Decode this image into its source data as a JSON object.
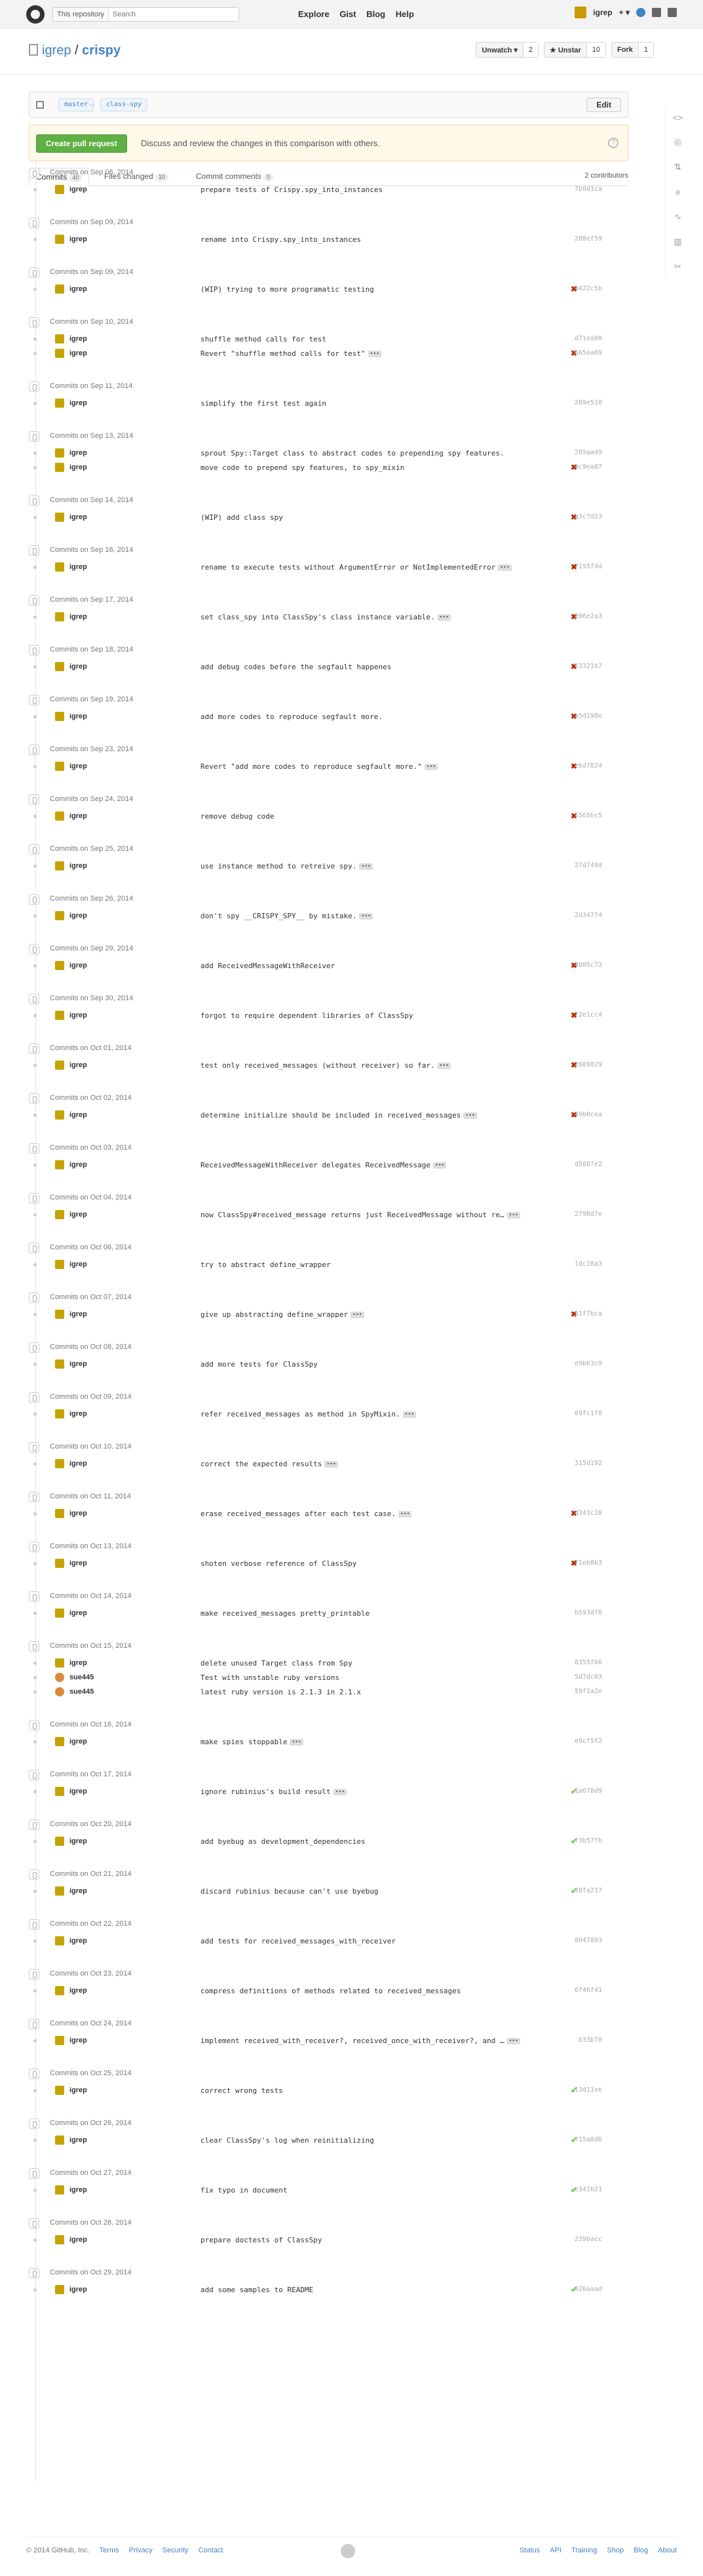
{
  "header": {
    "search_scope": "This repository",
    "search_placeholder": "Search",
    "nav": [
      "Explore",
      "Gist",
      "Blog",
      "Help"
    ],
    "username": "igrep",
    "plus": "+ ▾"
  },
  "repo": {
    "owner": "igrep",
    "separator": "/",
    "name": "crispy",
    "unwatch_label": "Unwatch ▾",
    "unwatch_count": "2",
    "unstar_label": "★ Unstar",
    "unstar_count": "10",
    "fork_label": "Fork",
    "fork_count": "1"
  },
  "compare": {
    "base": "master",
    "dots": "...",
    "head": "class-spy",
    "edit_label": "Edit",
    "pr_button": "Create pull request",
    "pr_text": "Discuss and review the changes in this comparison with others.",
    "help": "?"
  },
  "tabs": [
    {
      "label": "Commits",
      "count": "40"
    },
    {
      "label": "Files changed",
      "count": "10"
    },
    {
      "label": "Commit comments",
      "count": "0"
    }
  ],
  "contributors": "2 contributors",
  "groups": [
    {
      "date": "Commits on Sep 06, 2014",
      "commits": [
        {
          "author": "igrep",
          "message": "prepare tests of Crispy.spy_into_instances",
          "sha": "7b0d1ca",
          "status": ""
        }
      ]
    },
    {
      "date": "Commits on Sep 09, 2014",
      "commits": [
        {
          "author": "igrep",
          "message": "rename into Crispy.spy_into_instances",
          "sha": "288ef59",
          "status": ""
        }
      ]
    },
    {
      "date": "Commits on Sep 09, 2014",
      "commits": [
        {
          "author": "igrep",
          "message": "(WIP) trying to more programatic testing",
          "sha": "4422c5b",
          "status": "fail"
        }
      ]
    },
    {
      "date": "Commits on Sep 10, 2014",
      "commits": [
        {
          "author": "igrep",
          "message": "shuffle method calls for test",
          "sha": "d71ea80",
          "status": ""
        },
        {
          "author": "igrep",
          "message": "Revert \"shuffle method calls for test\"",
          "sha": "665ea69",
          "status": "fail",
          "ell": true
        }
      ]
    },
    {
      "date": "Commits on Sep 11, 2014",
      "commits": [
        {
          "author": "igrep",
          "message": "simplify the first test again",
          "sha": "289e510",
          "status": ""
        }
      ]
    },
    {
      "date": "Commits on Sep 13, 2014",
      "commits": [
        {
          "author": "igrep",
          "message": "sprout Spy::Target class to abstract codes to prepending spy features.",
          "sha": "285aa49",
          "status": ""
        },
        {
          "author": "igrep",
          "message": "move code to prepend spy features, to spy_mixin",
          "sha": "4c9ea07",
          "status": "fail"
        }
      ]
    },
    {
      "date": "Commits on Sep 14, 2014",
      "commits": [
        {
          "author": "igrep",
          "message": "(WIP) add class spy",
          "sha": "a3c7d23",
          "status": "fail"
        }
      ]
    },
    {
      "date": "Commits on Sep 16, 2014",
      "commits": [
        {
          "author": "igrep",
          "message": "rename to execute tests without ArgumentError or NotImplementedError",
          "sha": "7155f4d",
          "status": "fail",
          "ell": true
        }
      ]
    },
    {
      "date": "Commits on Sep 17, 2014",
      "commits": [
        {
          "author": "igrep",
          "message": "set class_spy into ClassSpy's class instance variable.",
          "sha": "896e2a3",
          "status": "fail",
          "ell": true
        }
      ]
    },
    {
      "date": "Commits on Sep 18, 2014",
      "commits": [
        {
          "author": "igrep",
          "message": "add debug codes before the segfault happenes",
          "sha": "63321b7",
          "status": "fail"
        }
      ]
    },
    {
      "date": "Commits on Sep 19, 2014",
      "commits": [
        {
          "author": "igrep",
          "message": "add more codes to reproduce segfault more.",
          "sha": "a5d198e",
          "status": "fail"
        }
      ]
    },
    {
      "date": "Commits on Sep 23, 2014",
      "commits": [
        {
          "author": "igrep",
          "message": "Revert \"add more codes to reproduce segfault more.\"",
          "sha": "e6d7824",
          "status": "fail",
          "ell": true
        }
      ]
    },
    {
      "date": "Commits on Sep 24, 2014",
      "commits": [
        {
          "author": "igrep",
          "message": "remove debug code",
          "sha": "5565bc5",
          "status": "fail"
        }
      ]
    },
    {
      "date": "Commits on Sep 25, 2014",
      "commits": [
        {
          "author": "igrep",
          "message": "use instance method to retreive spy.",
          "sha": "27d749d",
          "status": "",
          "ell": true
        }
      ]
    },
    {
      "date": "Commits on Sep 26, 2014",
      "commits": [
        {
          "author": "igrep",
          "message": "don't spy __CRISPY_SPY__ by mistake.",
          "sha": "2d347f4",
          "status": "",
          "ell": true
        }
      ]
    },
    {
      "date": "Commits on Sep 29, 2014",
      "commits": [
        {
          "author": "igrep",
          "message": "add ReceivedMessageWithReceiver",
          "sha": "4805c73",
          "status": "fail"
        }
      ]
    },
    {
      "date": "Commits on Sep 30, 2014",
      "commits": [
        {
          "author": "igrep",
          "message": "forgot to require dependent libraries of ClassSpy",
          "sha": "72e1cc4",
          "status": "fail"
        }
      ]
    },
    {
      "date": "Commits on Oct 01, 2014",
      "commits": [
        {
          "author": "igrep",
          "message": "test only received_messages (without receiver) so far.",
          "sha": "2889829",
          "status": "fail",
          "ell": true
        }
      ]
    },
    {
      "date": "Commits on Oct 02, 2014",
      "commits": [
        {
          "author": "igrep",
          "message": "determine initialize should be included in received_messages",
          "sha": "49b0cea",
          "status": "fail",
          "ell": true
        }
      ]
    },
    {
      "date": "Commits on Oct 03, 2014",
      "commits": [
        {
          "author": "igrep",
          "message": "ReceivedMessageWithReceiver delegates ReceivedMessage",
          "sha": "d5887e2",
          "status": "",
          "ell": true
        }
      ]
    },
    {
      "date": "Commits on Oct 04, 2014",
      "commits": [
        {
          "author": "igrep",
          "message": "now ClassSpy#received_message returns just ReceivedMessage without re…",
          "sha": "2798d7e",
          "status": "",
          "ell": true
        }
      ]
    },
    {
      "date": "Commits on Oct 06, 2014",
      "commits": [
        {
          "author": "igrep",
          "message": "try to abstract define_wrapper",
          "sha": "1dc28a3",
          "status": ""
        }
      ]
    },
    {
      "date": "Commits on Oct 07, 2014",
      "commits": [
        {
          "author": "igrep",
          "message": "give up abstracting define_wrapper",
          "sha": "51f7bca",
          "status": "fail",
          "ell": true
        }
      ]
    },
    {
      "date": "Commits on Oct 08, 2014",
      "commits": [
        {
          "author": "igrep",
          "message": "add more tests for ClassSpy",
          "sha": "e9b03c9",
          "status": ""
        }
      ]
    },
    {
      "date": "Commits on Oct 09, 2014",
      "commits": [
        {
          "author": "igrep",
          "message": "refer received_messages as method in SpyMixin.",
          "sha": "69fc1f8",
          "status": "",
          "ell": true
        }
      ]
    },
    {
      "date": "Commits on Oct 10, 2014",
      "commits": [
        {
          "author": "igrep",
          "message": "correct the expected results",
          "sha": "315d192",
          "status": "",
          "ell": true
        }
      ]
    },
    {
      "date": "Commits on Oct 11, 2014",
      "commits": [
        {
          "author": "igrep",
          "message": "erase received_messages after each test case.",
          "sha": "d343c28",
          "status": "fail",
          "ell": true
        }
      ]
    },
    {
      "date": "Commits on Oct 13, 2014",
      "commits": [
        {
          "author": "igrep",
          "message": "shoten verbose reference of ClassSpy",
          "sha": "71eb8b3",
          "status": "fail"
        }
      ]
    },
    {
      "date": "Commits on Oct 14, 2014",
      "commits": [
        {
          "author": "igrep",
          "message": "make received_messages pretty_printable",
          "sha": "b593df6",
          "status": ""
        }
      ]
    },
    {
      "date": "Commits on Oct 15, 2014",
      "commits": [
        {
          "author": "igrep",
          "message": "delete unused Target class from Spy",
          "sha": "8355f66",
          "status": ""
        },
        {
          "author": "sue445",
          "message": "Test with unstable ruby versions",
          "sha": "5d7dc03",
          "status": "",
          "alt": true
        },
        {
          "author": "sue445",
          "message": "latest ruby version is 2.1.3 in 2.1.x",
          "sha": "59f1a2e",
          "status": "",
          "alt": true
        }
      ]
    },
    {
      "date": "Commits on Oct 16, 2014",
      "commits": [
        {
          "author": "igrep",
          "message": "make spies stoppable",
          "sha": "e9cf5f2",
          "status": "",
          "ell": true
        }
      ]
    },
    {
      "date": "Commits on Oct 17, 2014",
      "commits": [
        {
          "author": "igrep",
          "message": "ignore rubinius's build result",
          "sha": "1a678d9",
          "status": "ok",
          "ell": true
        }
      ]
    },
    {
      "date": "Commits on Oct 20, 2014",
      "commits": [
        {
          "author": "igrep",
          "message": "add byebug as development_dependencies",
          "sha": "f3b57fb",
          "status": "ok"
        }
      ]
    },
    {
      "date": "Commits on Oct 21, 2014",
      "commits": [
        {
          "author": "igrep",
          "message": "discard rubinius because can't use byebug",
          "sha": "38fa217",
          "status": "ok"
        }
      ]
    },
    {
      "date": "Commits on Oct 22, 2014",
      "commits": [
        {
          "author": "igrep",
          "message": "add tests for received_messages_with_receiver",
          "sha": "0047893",
          "status": ""
        }
      ]
    },
    {
      "date": "Commits on Oct 23, 2014",
      "commits": [
        {
          "author": "igrep",
          "message": "compress definitions of methods related to received_messages",
          "sha": "6f46f41",
          "status": ""
        }
      ]
    },
    {
      "date": "Commits on Oct 24, 2014",
      "commits": [
        {
          "author": "igrep",
          "message": "implement received_with_receiver?, received_once_with_receiver?, and …",
          "sha": "b33b70",
          "status": "",
          "ell": true
        }
      ]
    },
    {
      "date": "Commits on Oct 25, 2014",
      "commits": [
        {
          "author": "igrep",
          "message": "correct wrong tests",
          "sha": "13d11ee",
          "status": "ok"
        }
      ]
    },
    {
      "date": "Commits on Oct 26, 2014",
      "commits": [
        {
          "author": "igrep",
          "message": "clear ClassSpy's log when reinitializing",
          "sha": "715a8d6",
          "status": "ok"
        }
      ]
    },
    {
      "date": "Commits on Oct 27, 2014",
      "commits": [
        {
          "author": "igrep",
          "message": "fix typo in document",
          "sha": "e341b21",
          "status": "ok"
        }
      ]
    },
    {
      "date": "Commits on Oct 28, 2014",
      "commits": [
        {
          "author": "igrep",
          "message": "prepare doctests of ClassSpy",
          "sha": "2396acc",
          "status": ""
        }
      ]
    },
    {
      "date": "Commits on Oct 29, 2014",
      "commits": [
        {
          "author": "igrep",
          "message": "add some samples to README",
          "sha": "826aaad",
          "status": "ok"
        }
      ]
    }
  ],
  "status_glyphs": {
    "fail": "✖",
    "ok": "✔"
  },
  "footer": {
    "copyright": "© 2014 GitHub, Inc.",
    "left_links": [
      "Terms",
      "Privacy",
      "Security",
      "Contact"
    ],
    "right_links": [
      "Status",
      "API",
      "Training",
      "Shop",
      "Blog",
      "About"
    ]
  },
  "colors": {
    "accent": "#4183c4",
    "fail": "#bd2c00",
    "ok": "#6cc644",
    "pr_green": "#60b044"
  }
}
